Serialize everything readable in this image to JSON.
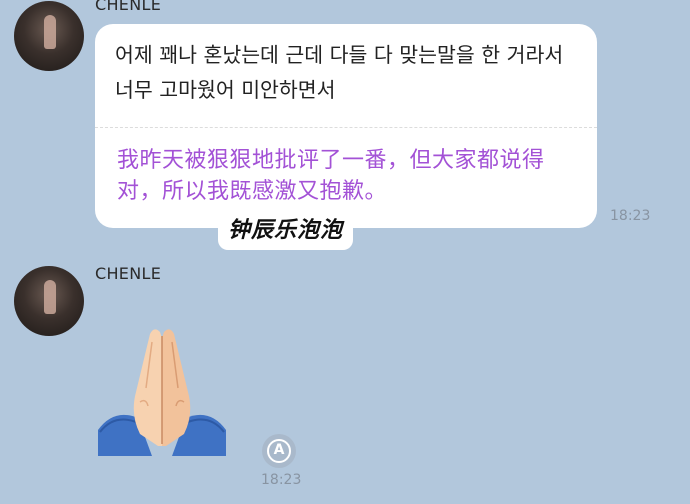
{
  "messages": [
    {
      "sender": "CHENLE",
      "text_ko": "어제 꽤나 혼났는데 근데 다들 다 맞는말을 한 거라서 너무 고마웠어 미안하면서",
      "translation": "我昨天被狠狠地批评了一番，但大家都说得对，所以我既感激又抱歉。",
      "time": "18:23"
    },
    {
      "sender": "CHENLE",
      "emoji": "folded-hands",
      "time": "18:23"
    }
  ],
  "watermark": "钟辰乐泡泡",
  "translate_button": "A",
  "colors": {
    "background": "#b2c7dc",
    "bubble": "#ffffff",
    "translation_text": "#a352d6"
  }
}
